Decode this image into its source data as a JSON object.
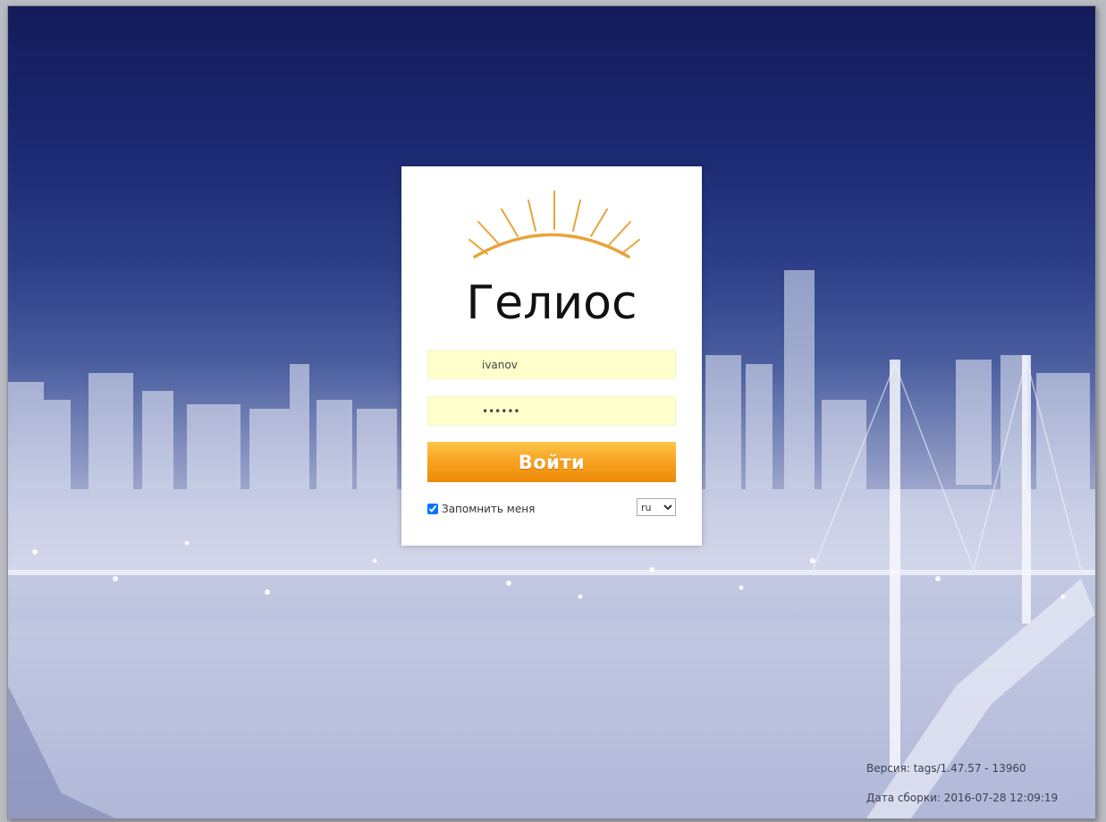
{
  "login": {
    "logo_text": "Гелиос",
    "username_value": "ivanov",
    "password_value": "••••••",
    "submit_label": "Войти",
    "remember_label": "Запомнить меня",
    "remember_checked": true,
    "language_selected": "ru"
  },
  "footer": {
    "version": "Версия: tags/1.47.57 - 13960",
    "build_date": "Дата сборки: 2016-07-28 12:09:19"
  },
  "theme": {
    "field_background": "#ffffcc",
    "button_color": "#f8a423",
    "logo_rays_color": "#e8a43a"
  }
}
